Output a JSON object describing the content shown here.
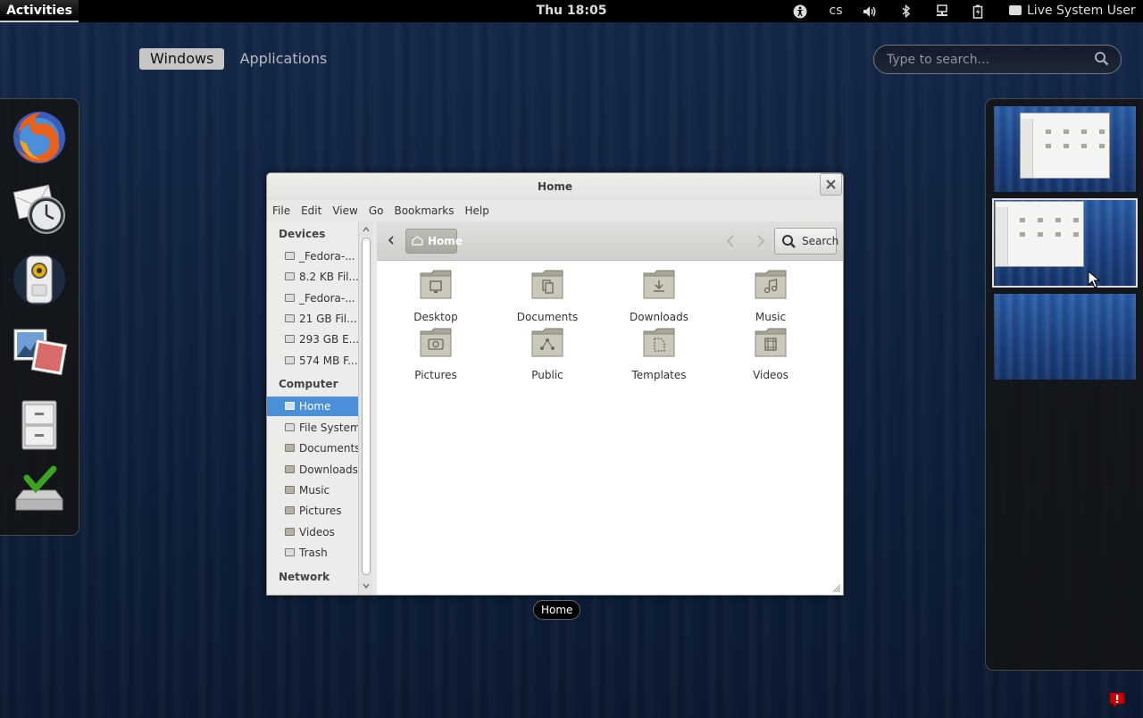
{
  "topbar": {
    "activities": "Activities",
    "clock": "Thu 18:05",
    "keyboard_layout": "cs",
    "user": "Live System User"
  },
  "overview": {
    "tabs": [
      {
        "label": "Windows",
        "active": true
      },
      {
        "label": "Applications",
        "active": false
      }
    ],
    "search_placeholder": "Type to search..."
  },
  "dash": {
    "apps": [
      "firefox-icon",
      "evolution-mail-icon",
      "rhythmbox-icon",
      "shotwell-icon",
      "files-icon",
      "install-to-hard-drive-icon"
    ]
  },
  "window": {
    "title": "Home",
    "menu": [
      "File",
      "Edit",
      "View",
      "Go",
      "Bookmarks",
      "Help"
    ],
    "sidebar": {
      "devices_header": "Devices",
      "devices": [
        "_Fedora-...",
        "8.2 KB Fil...",
        "_Fedora-...",
        "21 GB Fil...",
        "293 GB E...",
        "574 MB F..."
      ],
      "computer_header": "Computer",
      "computer": [
        "Home",
        "File System",
        "Documents",
        "Downloads",
        "Music",
        "Pictures",
        "Videos",
        "Trash"
      ],
      "network_header": "Network"
    },
    "path_button": "Home",
    "search_button": "Search",
    "files": [
      "Desktop",
      "Documents",
      "Downloads",
      "Music",
      "Pictures",
      "Public",
      "Templates",
      "Videos"
    ]
  },
  "window_label": "Home",
  "colors": {
    "accent": "#4a90d9",
    "folder": "#b3b2a3",
    "badge": "#cc0000"
  }
}
